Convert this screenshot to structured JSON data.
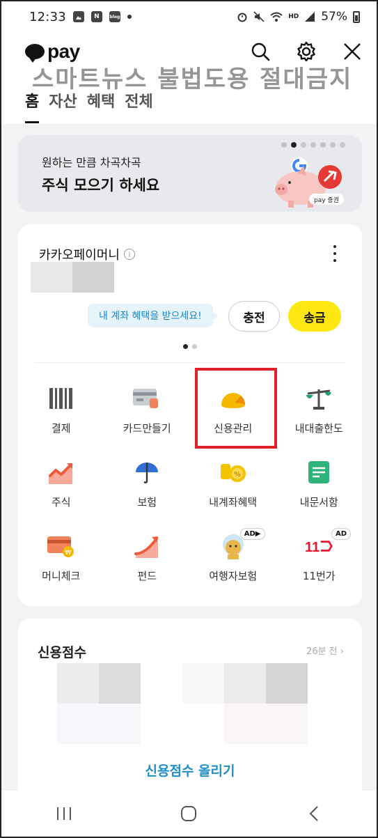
{
  "status_bar": {
    "time": "12:33",
    "battery": "57%",
    "notif_icons": [
      "gallery-icon",
      "naver-icon",
      "blog-icon"
    ],
    "naver_letter": "N",
    "blog_label": "blog",
    "network_label": "HD"
  },
  "header": {
    "logo_text": "pay",
    "watermark": "스마트뉴스 불법도용 절대금지",
    "tabs": [
      {
        "label": "홈",
        "active": true
      },
      {
        "label": "자산",
        "active": false
      },
      {
        "label": "혜택",
        "active": false
      },
      {
        "label": "전체",
        "active": false
      }
    ]
  },
  "banner": {
    "subtitle": "원하는 만큼 차곡차곡",
    "title": "주식 모으기 하세요",
    "badge": "pay 증권",
    "pages": 7,
    "current_page": 2
  },
  "money_card": {
    "title": "카카오페이머니",
    "promo": "내 계좌 혜택을 받으세요!",
    "charge_label": "충전",
    "send_label": "송금",
    "pages": 2,
    "current_page": 1
  },
  "menu": [
    {
      "label": "결제",
      "icon": "barcode-icon"
    },
    {
      "label": "카드만들기",
      "icon": "card-icon"
    },
    {
      "label": "신용관리",
      "icon": "credit-gauge-icon"
    },
    {
      "label": "내대출한도",
      "icon": "scale-icon"
    },
    {
      "label": "주식",
      "icon": "stock-chart-icon"
    },
    {
      "label": "보험",
      "icon": "umbrella-icon"
    },
    {
      "label": "내계좌혜택",
      "icon": "coin-percent-icon"
    },
    {
      "label": "내문서함",
      "icon": "document-icon"
    },
    {
      "label": "머니체크",
      "icon": "money-check-icon"
    },
    {
      "label": "펀드",
      "icon": "fund-chart-icon"
    },
    {
      "label": "여행자보험",
      "icon": "travel-character-icon",
      "ad": "AD▶"
    },
    {
      "label": "11번가",
      "icon": "11st-logo-icon",
      "ad": "AD"
    }
  ],
  "credit_card": {
    "title": "신용점수",
    "updated": "26분 전",
    "cta": "신용점수 올리기"
  },
  "colors": {
    "accent_yellow": "#ffe812",
    "link_blue": "#1f8fc9",
    "highlight_red": "#e0202a"
  }
}
